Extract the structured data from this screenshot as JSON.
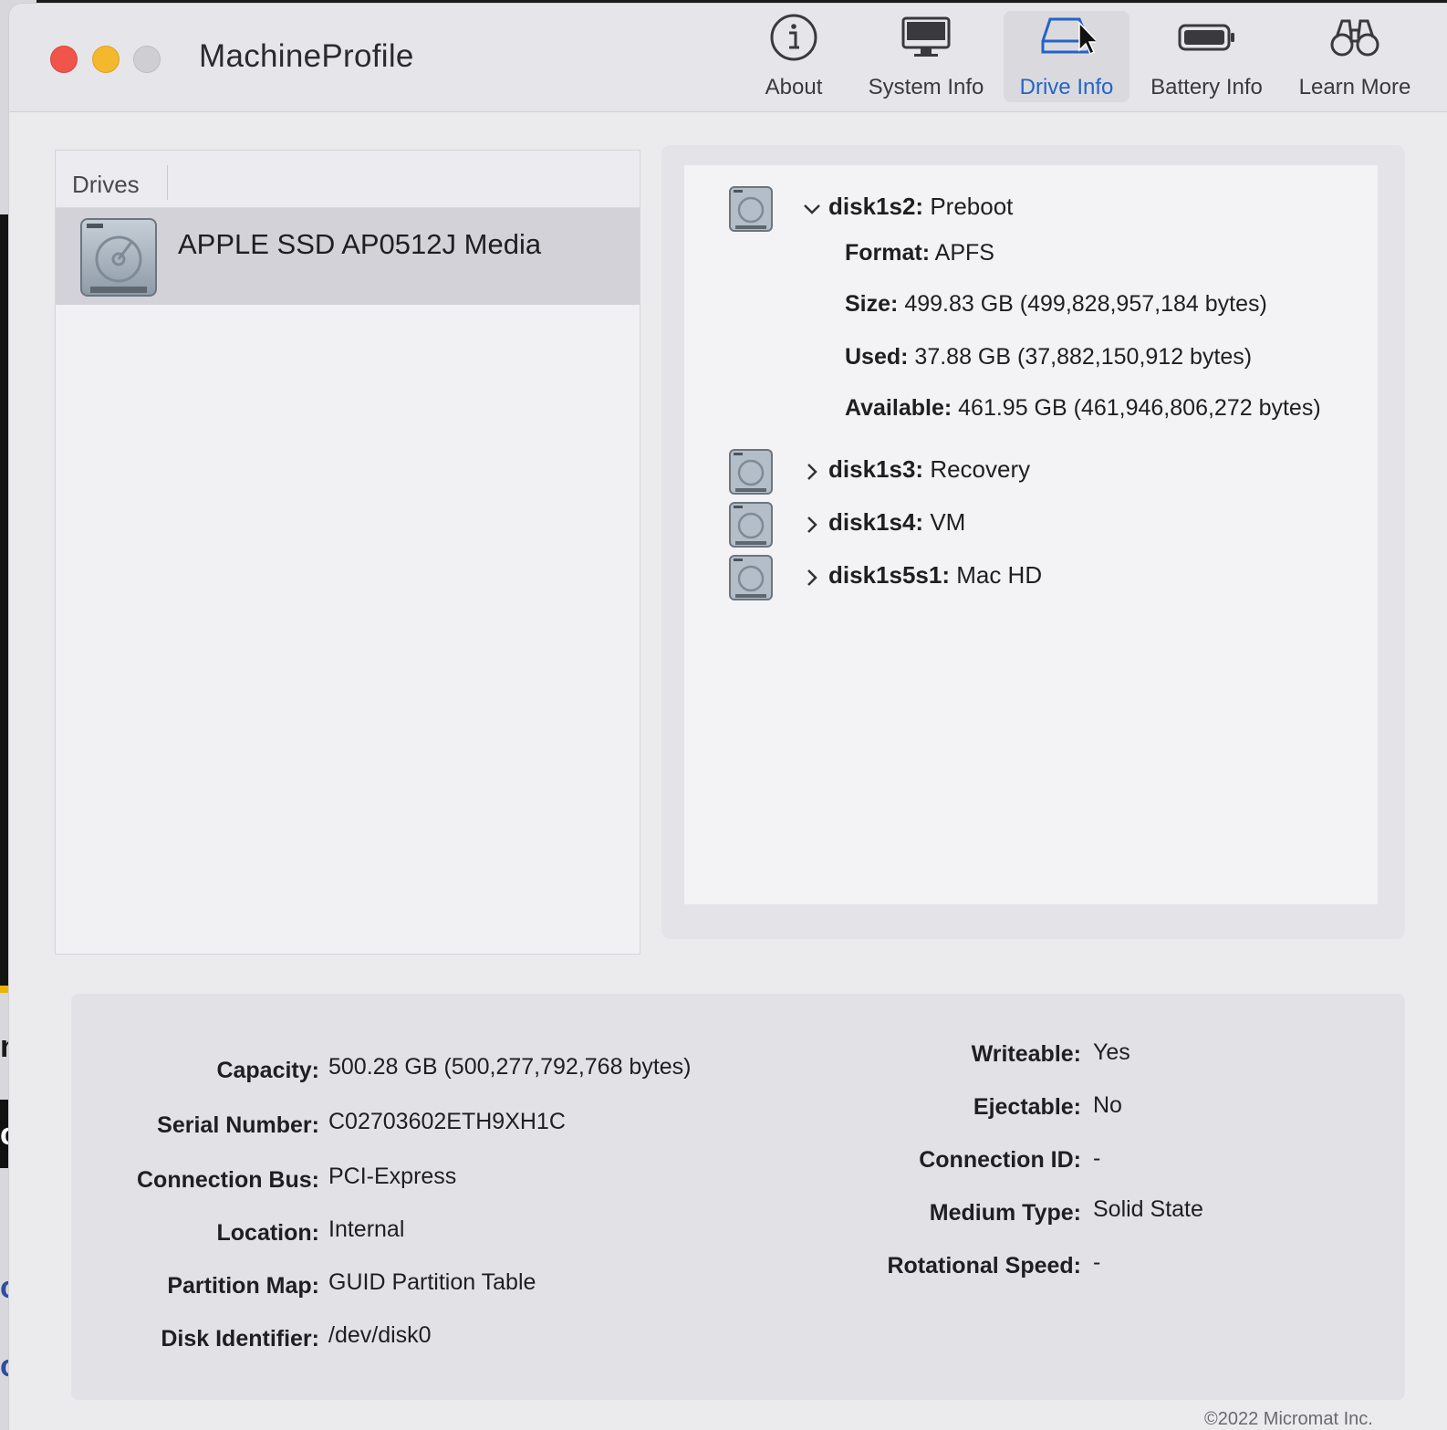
{
  "background_fragments": [
    "nt",
    "cri",
    "os:",
    "ore"
  ],
  "app": {
    "title": "MachineProfile"
  },
  "toolbar": {
    "about": "About",
    "system_info": "System Info",
    "drive_info": "Drive Info",
    "battery_info": "Battery Info",
    "learn_more": "Learn More"
  },
  "drives": {
    "header": "Drives",
    "items": [
      {
        "name": "APPLE SSD AP0512J Media"
      }
    ]
  },
  "partitions": {
    "expanded": {
      "id": "disk1s2:",
      "name": "Preboot",
      "format_label": "Format:",
      "format_value": "APFS",
      "size_label": "Size:",
      "size_value": "499.83 GB (499,828,957,184 bytes)",
      "used_label": "Used:",
      "used_value": "37.88 GB (37,882,150,912 bytes)",
      "available_label": "Available:",
      "available_value": "461.95 GB (461,946,806,272 bytes)"
    },
    "collapsed": [
      {
        "id": "disk1s3:",
        "name": "Recovery"
      },
      {
        "id": "disk1s4:",
        "name": "VM"
      },
      {
        "id": "disk1s5s1:",
        "name": "Mac HD"
      }
    ]
  },
  "info": {
    "left": [
      {
        "label": "Capacity:",
        "value": "500.28 GB (500,277,792,768 bytes)"
      },
      {
        "label": "Serial Number:",
        "value": "C02703602ETH9XH1C"
      },
      {
        "label": "Connection Bus:",
        "value": "PCI-Express"
      },
      {
        "label": "Location:",
        "value": "Internal"
      },
      {
        "label": "Partition Map:",
        "value": "GUID Partition Table"
      },
      {
        "label": "Disk Identifier:",
        "value": "/dev/disk0"
      }
    ],
    "right": [
      {
        "label": "Writeable:",
        "value": "Yes"
      },
      {
        "label": "Ejectable:",
        "value": "No"
      },
      {
        "label": "Connection ID:",
        "value": "-"
      },
      {
        "label": "Medium Type:",
        "value": "Solid State"
      },
      {
        "label": "Rotational Speed:",
        "value": "-"
      }
    ]
  },
  "footer": "©2022 Micromat Inc.",
  "colors": {
    "accent": "#2563c9",
    "close": "#f0554c",
    "minimize": "#f4b82e"
  }
}
